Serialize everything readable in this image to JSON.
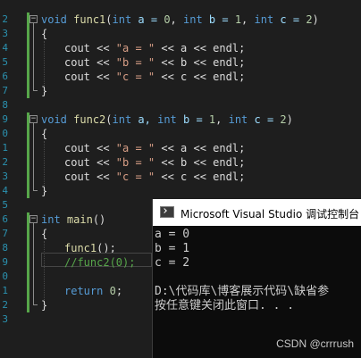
{
  "editor": {
    "line_numbers": [
      "2",
      "3",
      "4",
      "5",
      "6",
      "7",
      "8",
      "9",
      "0",
      "1",
      "2",
      "3",
      "4",
      "5",
      "6",
      "7",
      "8",
      "9",
      "0",
      "1",
      "2",
      "3"
    ],
    "code": {
      "func1_sig": {
        "kw": "void",
        "name": "func1",
        "open": "(",
        "p1t": "int",
        "p1": " a = ",
        "p1v": "0",
        "c1": ", ",
        "p2t": "int",
        "p2": " b = ",
        "p2v": "1",
        "c2": ", ",
        "p3t": "int",
        "p3": " c = ",
        "p3v": "2",
        "close": ")"
      },
      "open_brace": "{",
      "close_brace": "}",
      "func1_body": [
        {
          "a": "cout << ",
          "s": "\"a = \"",
          "b": " << a << endl;"
        },
        {
          "a": "cout << ",
          "s": "\"b = \"",
          "b": " << b << endl;"
        },
        {
          "a": "cout << ",
          "s": "\"c = \"",
          "b": " << c << endl;"
        }
      ],
      "func2_sig": {
        "kw": "void",
        "name": "func2",
        "open": "(",
        "p1t": "int",
        "p1": " a, ",
        "p2t": "int",
        "p2": " b = ",
        "p2v": "1",
        "c2": ", ",
        "p3t": "int",
        "p3": " c = ",
        "p3v": "2",
        "close": ")"
      },
      "func2_body": [
        {
          "a": "cout << ",
          "s": "\"a = \"",
          "b": " << a << endl;"
        },
        {
          "a": "cout << ",
          "s": "\"b = \"",
          "b": " << b << endl;"
        },
        {
          "a": "cout << ",
          "s": "\"c = \"",
          "b": " << c << endl;"
        }
      ],
      "main_sig": {
        "kw": "int",
        "name": " main",
        "rest": "()"
      },
      "call1": {
        "name": "func1",
        "rest": "();"
      },
      "call2_comment": "//func2(0);",
      "ret": {
        "kw": "return",
        "rest": " ",
        "val": "0",
        "end": ";"
      }
    },
    "fold_minus": "−"
  },
  "console": {
    "title": "Microsoft Visual Studio 调试控制台",
    "lines": [
      "a = 0",
      "b = 1",
      "c = 2",
      "",
      "D:\\代码库\\博客展示代码\\缺省参",
      "按任意键关闭此窗口. . ."
    ]
  },
  "watermark": "CSDN @crrrush",
  "colors": {
    "background": "#1e1e1e",
    "keyword": "#569cd6",
    "function": "#dcdcaa",
    "string": "#d69d85",
    "number": "#b5cea8",
    "comment": "#57a64a",
    "line_number": "#2b91af",
    "console_bg": "#0c0c0c"
  }
}
